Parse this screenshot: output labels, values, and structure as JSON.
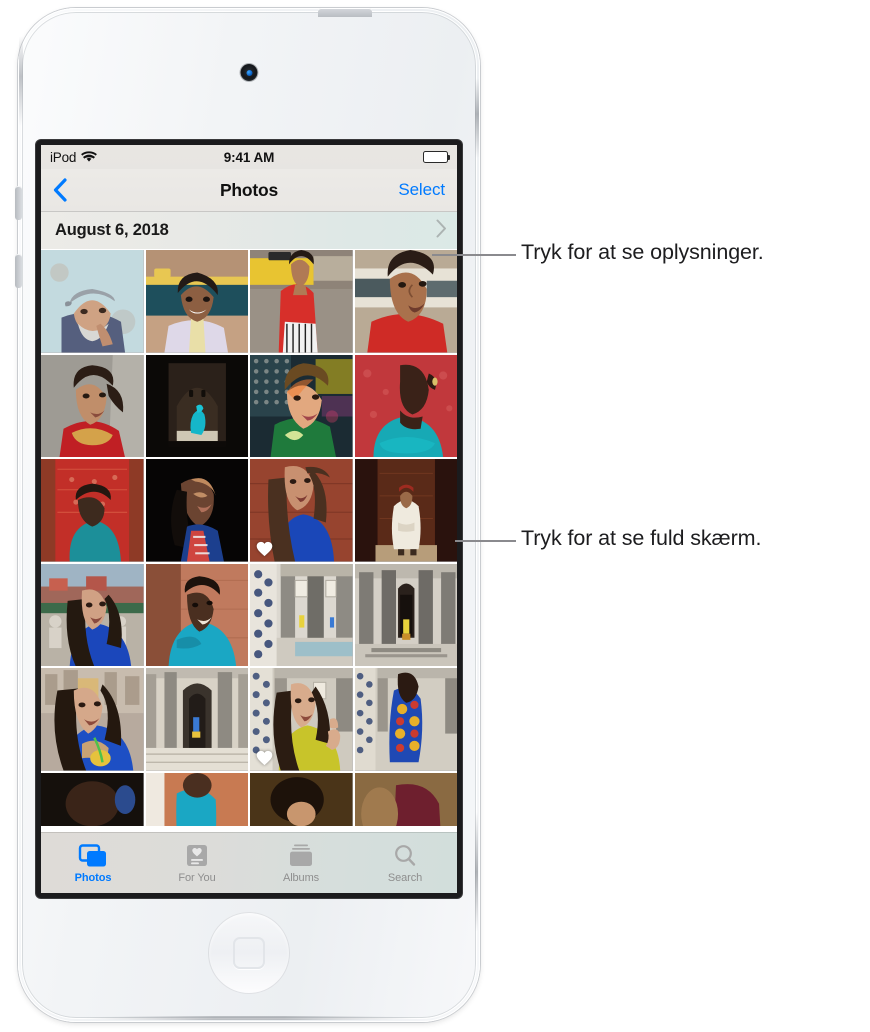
{
  "device": {
    "name": "iPod touch",
    "camera": "front-camera",
    "home_button": "home-button"
  },
  "status_bar": {
    "carrier": "iPod",
    "wifi_icon": "wifi-icon",
    "time": "9:41 AM",
    "battery_icon": "battery-full-icon"
  },
  "nav_bar": {
    "back_icon": "chevron-left-icon",
    "title": "Photos",
    "select_label": "Select"
  },
  "date_header": {
    "date": "August 6, 2018",
    "chevron_icon": "chevron-right-icon"
  },
  "photo_grid": {
    "columns": 4,
    "rows": [
      [
        {
          "id": "p1",
          "desc": "older-man-flat-cap-blue-wall",
          "favorite": false
        },
        {
          "id": "p2",
          "desc": "girl-smiling-white-embroidered",
          "favorite": false
        },
        {
          "id": "p3",
          "desc": "woman-red-top-taxi",
          "favorite": false
        },
        {
          "id": "p4",
          "desc": "woman-red-sweater-portrait",
          "favorite": false
        }
      ],
      [
        {
          "id": "p5",
          "desc": "woman-red-gold-dress-ponytail",
          "favorite": false
        },
        {
          "id": "p6",
          "desc": "teal-figure-dark-archway",
          "favorite": false
        },
        {
          "id": "p7",
          "desc": "woman-neon-light-portrait",
          "favorite": false
        },
        {
          "id": "p8",
          "desc": "woman-teal-robe-red-wall",
          "favorite": false
        }
      ],
      [
        {
          "id": "p9",
          "desc": "man-teal-robe-red-textile",
          "favorite": false
        },
        {
          "id": "p10",
          "desc": "woman-dark-portrait-sunlight",
          "favorite": false
        },
        {
          "id": "p11",
          "desc": "woman-blue-shirt-long-hair",
          "favorite": true
        },
        {
          "id": "p12",
          "desc": "man-white-robe-red-fez-seated",
          "favorite": false
        }
      ],
      [
        {
          "id": "p13",
          "desc": "woman-blue-shirt-market-square",
          "favorite": false
        },
        {
          "id": "p14",
          "desc": "man-blue-shirt-pink-wall",
          "favorite": false
        },
        {
          "id": "p15",
          "desc": "riad-courtyard-tiled-columns",
          "favorite": false
        },
        {
          "id": "p16",
          "desc": "riad-corridor-columns-doorway",
          "favorite": false
        }
      ],
      [
        {
          "id": "p17",
          "desc": "woman-blue-shirt-drinking-juice",
          "favorite": false
        },
        {
          "id": "p18",
          "desc": "riad-hallway-arches",
          "favorite": false
        },
        {
          "id": "p19",
          "desc": "woman-yellow-top-thumbs-up",
          "favorite": true
        },
        {
          "id": "p20",
          "desc": "woman-patterned-jacket-courtyard",
          "favorite": false
        }
      ],
      [
        {
          "id": "p21",
          "desc": "partial-dark-scene",
          "favorite": false
        },
        {
          "id": "p22",
          "desc": "partial-man-teal-shirt",
          "favorite": false
        },
        {
          "id": "p23",
          "desc": "partial-woman-dark-hair",
          "favorite": false
        },
        {
          "id": "p24",
          "desc": "partial-maroon-garment",
          "favorite": false
        }
      ]
    ]
  },
  "tab_bar": {
    "items": [
      {
        "label": "Photos",
        "icon": "photos-stack-icon",
        "active": true
      },
      {
        "label": "For You",
        "icon": "for-you-heart-card-icon",
        "active": false
      },
      {
        "label": "Albums",
        "icon": "albums-icon",
        "active": false
      },
      {
        "label": "Search",
        "icon": "search-magnifier-icon",
        "active": false
      }
    ]
  },
  "callouts": [
    {
      "text": "Tryk for at se oplysninger."
    },
    {
      "text": "Tryk for at se fuld skærm."
    }
  ],
  "colors": {
    "ios_blue": "#007aff",
    "inactive_gray": "#8e8e8e",
    "screen_bg": "#ffffff",
    "callout_line": "#8a8a8e"
  }
}
